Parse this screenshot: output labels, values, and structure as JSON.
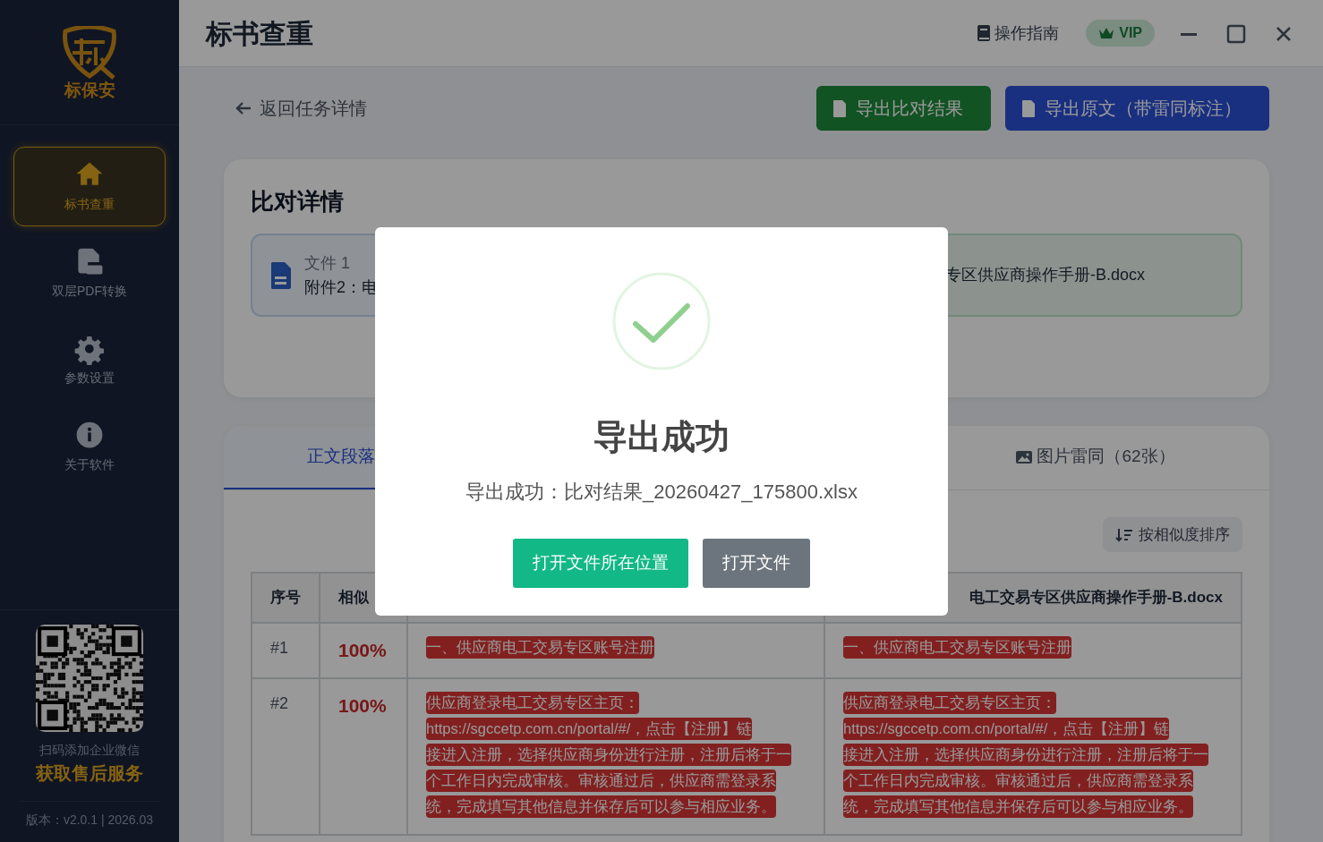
{
  "sidebar": {
    "logo_text": "标保安",
    "nav": [
      {
        "label": "标书查重",
        "kind": "home",
        "selected": true
      },
      {
        "label": "双层PDF转换",
        "kind": "pdf",
        "selected": false
      },
      {
        "label": "参数设置",
        "kind": "gear",
        "selected": false
      },
      {
        "label": "关于软件",
        "kind": "info",
        "selected": false
      }
    ],
    "qr_caption": "扫码添加企业微信",
    "service": "获取售后服务",
    "version": "版本：v2.0.1 | 2026.03"
  },
  "header": {
    "title": "标书查重",
    "guide": "操作指南",
    "vip": "VIP"
  },
  "toolbar": {
    "back": "返回任务详情",
    "buttons": [
      {
        "label": "导出比对结果",
        "kind": "excel"
      },
      {
        "label": "导出原文（带雷同标注）",
        "kind": "word"
      }
    ]
  },
  "details": {
    "title": "比对详情",
    "files": [
      {
        "label": "文件 1",
        "name": "附件2：电"
      },
      {
        "name": "专区供应商操作手册-B.docx"
      }
    ]
  },
  "tabs": [
    {
      "label": "正文段落",
      "selected": true
    },
    {
      "label": "图片雷同（62张）",
      "selected": false
    }
  ],
  "sort_button": "按相似度排序",
  "table": {
    "columns": [
      {
        "label": "序号"
      },
      {
        "label": "相似"
      },
      {},
      {
        "label": "电工交易专区供应商操作手册-B.docx"
      }
    ],
    "rows": [
      {
        "index": "#1",
        "similarity": "100%",
        "text_a": "一、供应商电工交易专区账号注册",
        "text_b": "一、供应商电工交易专区账号注册"
      },
      {
        "index": "#2",
        "similarity": "100%",
        "text_a": [
          "供应商登录电工交易专区主页：",
          "https://sgccetp.com.cn/portal/#/，点击【注册】链",
          "接进入注册，选择供应商身份进行注册，注册后将于一",
          "个工作日内完成审核。审核通过后，供应商需登录系",
          "统，完成填写其他信息并保存后可以参与相应业务。"
        ],
        "text_b": [
          "供应商登录电工交易专区主页：",
          "https://sgccetp.com.cn/portal/#/，点击【注册】链",
          "接进入注册，选择供应商身份进行注册，注册后将于一",
          "个工作日内完成审核。审核通过后，供应商需登录系",
          "统，完成填写其他信息并保存后可以参与相应业务。"
        ]
      }
    ]
  },
  "modal": {
    "title": "导出成功",
    "message": "导出成功：比对结果_20260427_175800.xlsx",
    "buttons": [
      {
        "label": "打开文件所在位置",
        "kind": "primary"
      },
      {
        "label": "打开文件",
        "kind": "secondary"
      }
    ]
  }
}
